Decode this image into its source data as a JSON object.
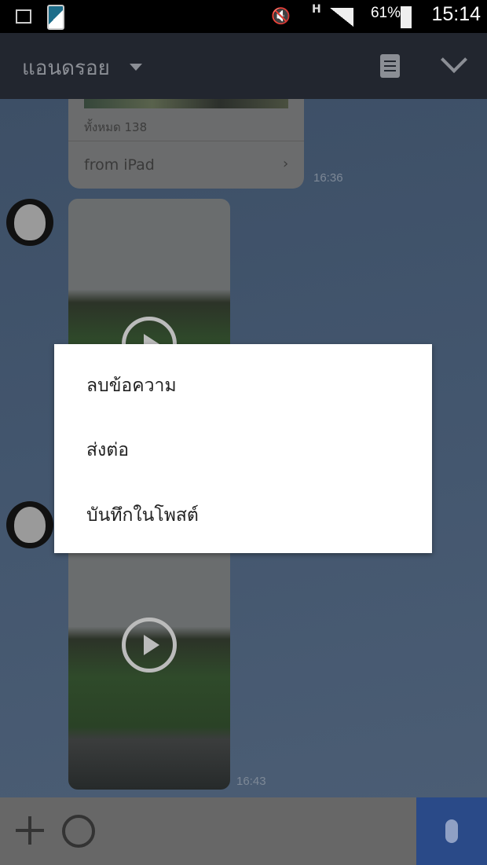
{
  "status_bar": {
    "battery": "61%",
    "time": "15:14",
    "icons": [
      "image-icon",
      "phone-icon",
      "vibrate-mute-icon",
      "hspa-icon",
      "signal-icon",
      "battery-charging-icon"
    ]
  },
  "header": {
    "title": "แอนดรอย",
    "icons": [
      "dropdown-icon",
      "notes-icon",
      "chevron-down-icon"
    ]
  },
  "messages": [
    {
      "type": "album",
      "count_label": "ทั้งหมด 138",
      "link_label": "from iPad",
      "time": "16:36"
    },
    {
      "type": "video",
      "time": ""
    },
    {
      "type": "video",
      "time": "16:43"
    }
  ],
  "context_menu": {
    "items": [
      {
        "label": "ลบข้อความ"
      },
      {
        "label": "ส่งต่อ"
      },
      {
        "label": "บันทึกในโพสต์"
      }
    ]
  },
  "input_bar": {
    "icons": [
      "plus-icon",
      "emoji-icon",
      "microphone-icon"
    ]
  },
  "colors": {
    "header": "#22262f",
    "accent": "#2a4a88",
    "dialog": "#ffffff"
  }
}
